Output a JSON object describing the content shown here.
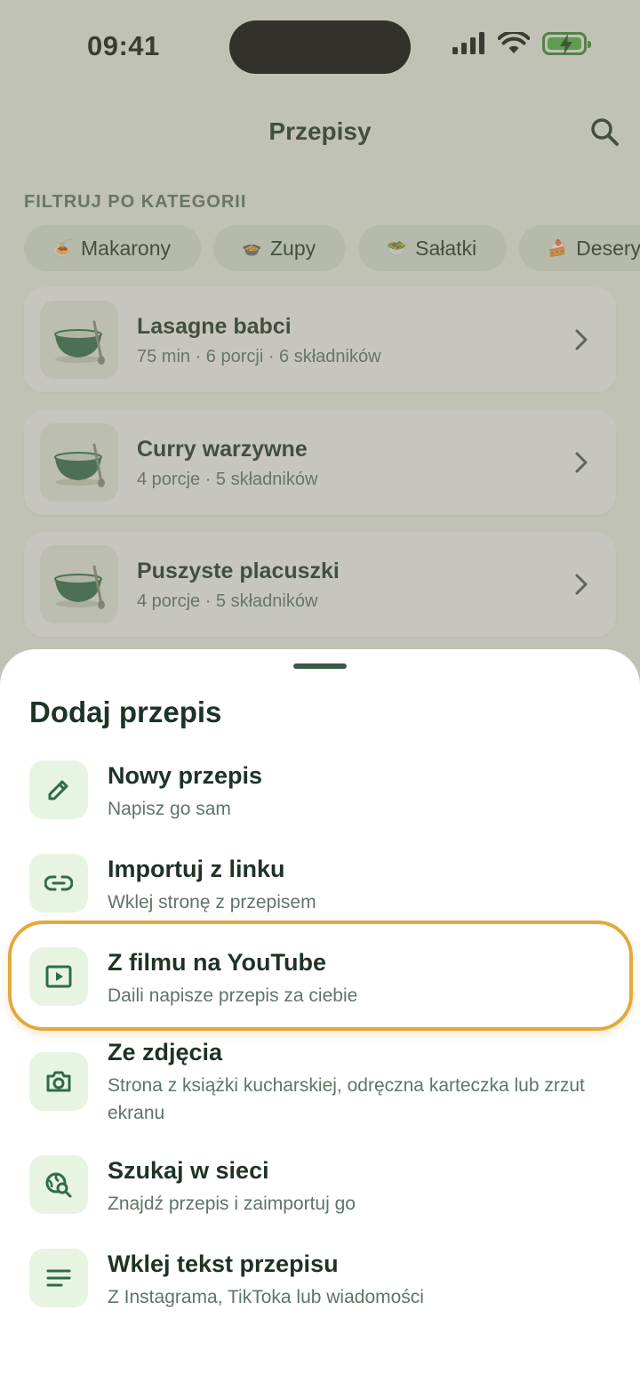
{
  "status_bar": {
    "time": "09:41"
  },
  "header": {
    "title": "Przepisy"
  },
  "filter": {
    "label": "FILTRUJ PO KATEGORII",
    "chips": [
      {
        "emoji": "🍝",
        "label": "Makarony"
      },
      {
        "emoji": "🍲",
        "label": "Zupy"
      },
      {
        "emoji": "🥗",
        "label": "Sałatki"
      },
      {
        "emoji": "🍰",
        "label": "Desery"
      }
    ]
  },
  "recipes": [
    {
      "title": "Lasagne babci",
      "meta": "75 min · 6 porcji · 6 składników"
    },
    {
      "title": "Curry warzywne",
      "meta": "4 porcje · 5 składników"
    },
    {
      "title": "Puszyste placuszki",
      "meta": "4 porcje · 5 składników"
    }
  ],
  "sheet": {
    "title": "Dodaj przepis",
    "options": [
      {
        "icon": "pencil-icon",
        "title": "Nowy przepis",
        "subtitle": "Napisz go sam"
      },
      {
        "icon": "link-icon",
        "title": "Importuj z linku",
        "subtitle": "Wklej stronę z przepisem"
      },
      {
        "icon": "video-play-icon",
        "title": "Z filmu na YouTube",
        "subtitle": "Daili napisze przepis za ciebie"
      },
      {
        "icon": "camera-icon",
        "title": "Ze zdjęcia",
        "subtitle": "Strona z książki kucharskiej, odręczna karteczka lub zrzut ekranu"
      },
      {
        "icon": "web-search-icon",
        "title": "Szukaj w sieci",
        "subtitle": "Znajdź przepis i zaimportuj go"
      },
      {
        "icon": "text-lines-icon",
        "title": "Wklej tekst przepisu",
        "subtitle": "Z Instagrama, TikToka lub wiadomości"
      }
    ]
  },
  "colors": {
    "primary": "#1e3324",
    "accent_green": "#2f6b4a",
    "highlight": "#e3a93c",
    "icon_bg": "#e8f4e2"
  }
}
